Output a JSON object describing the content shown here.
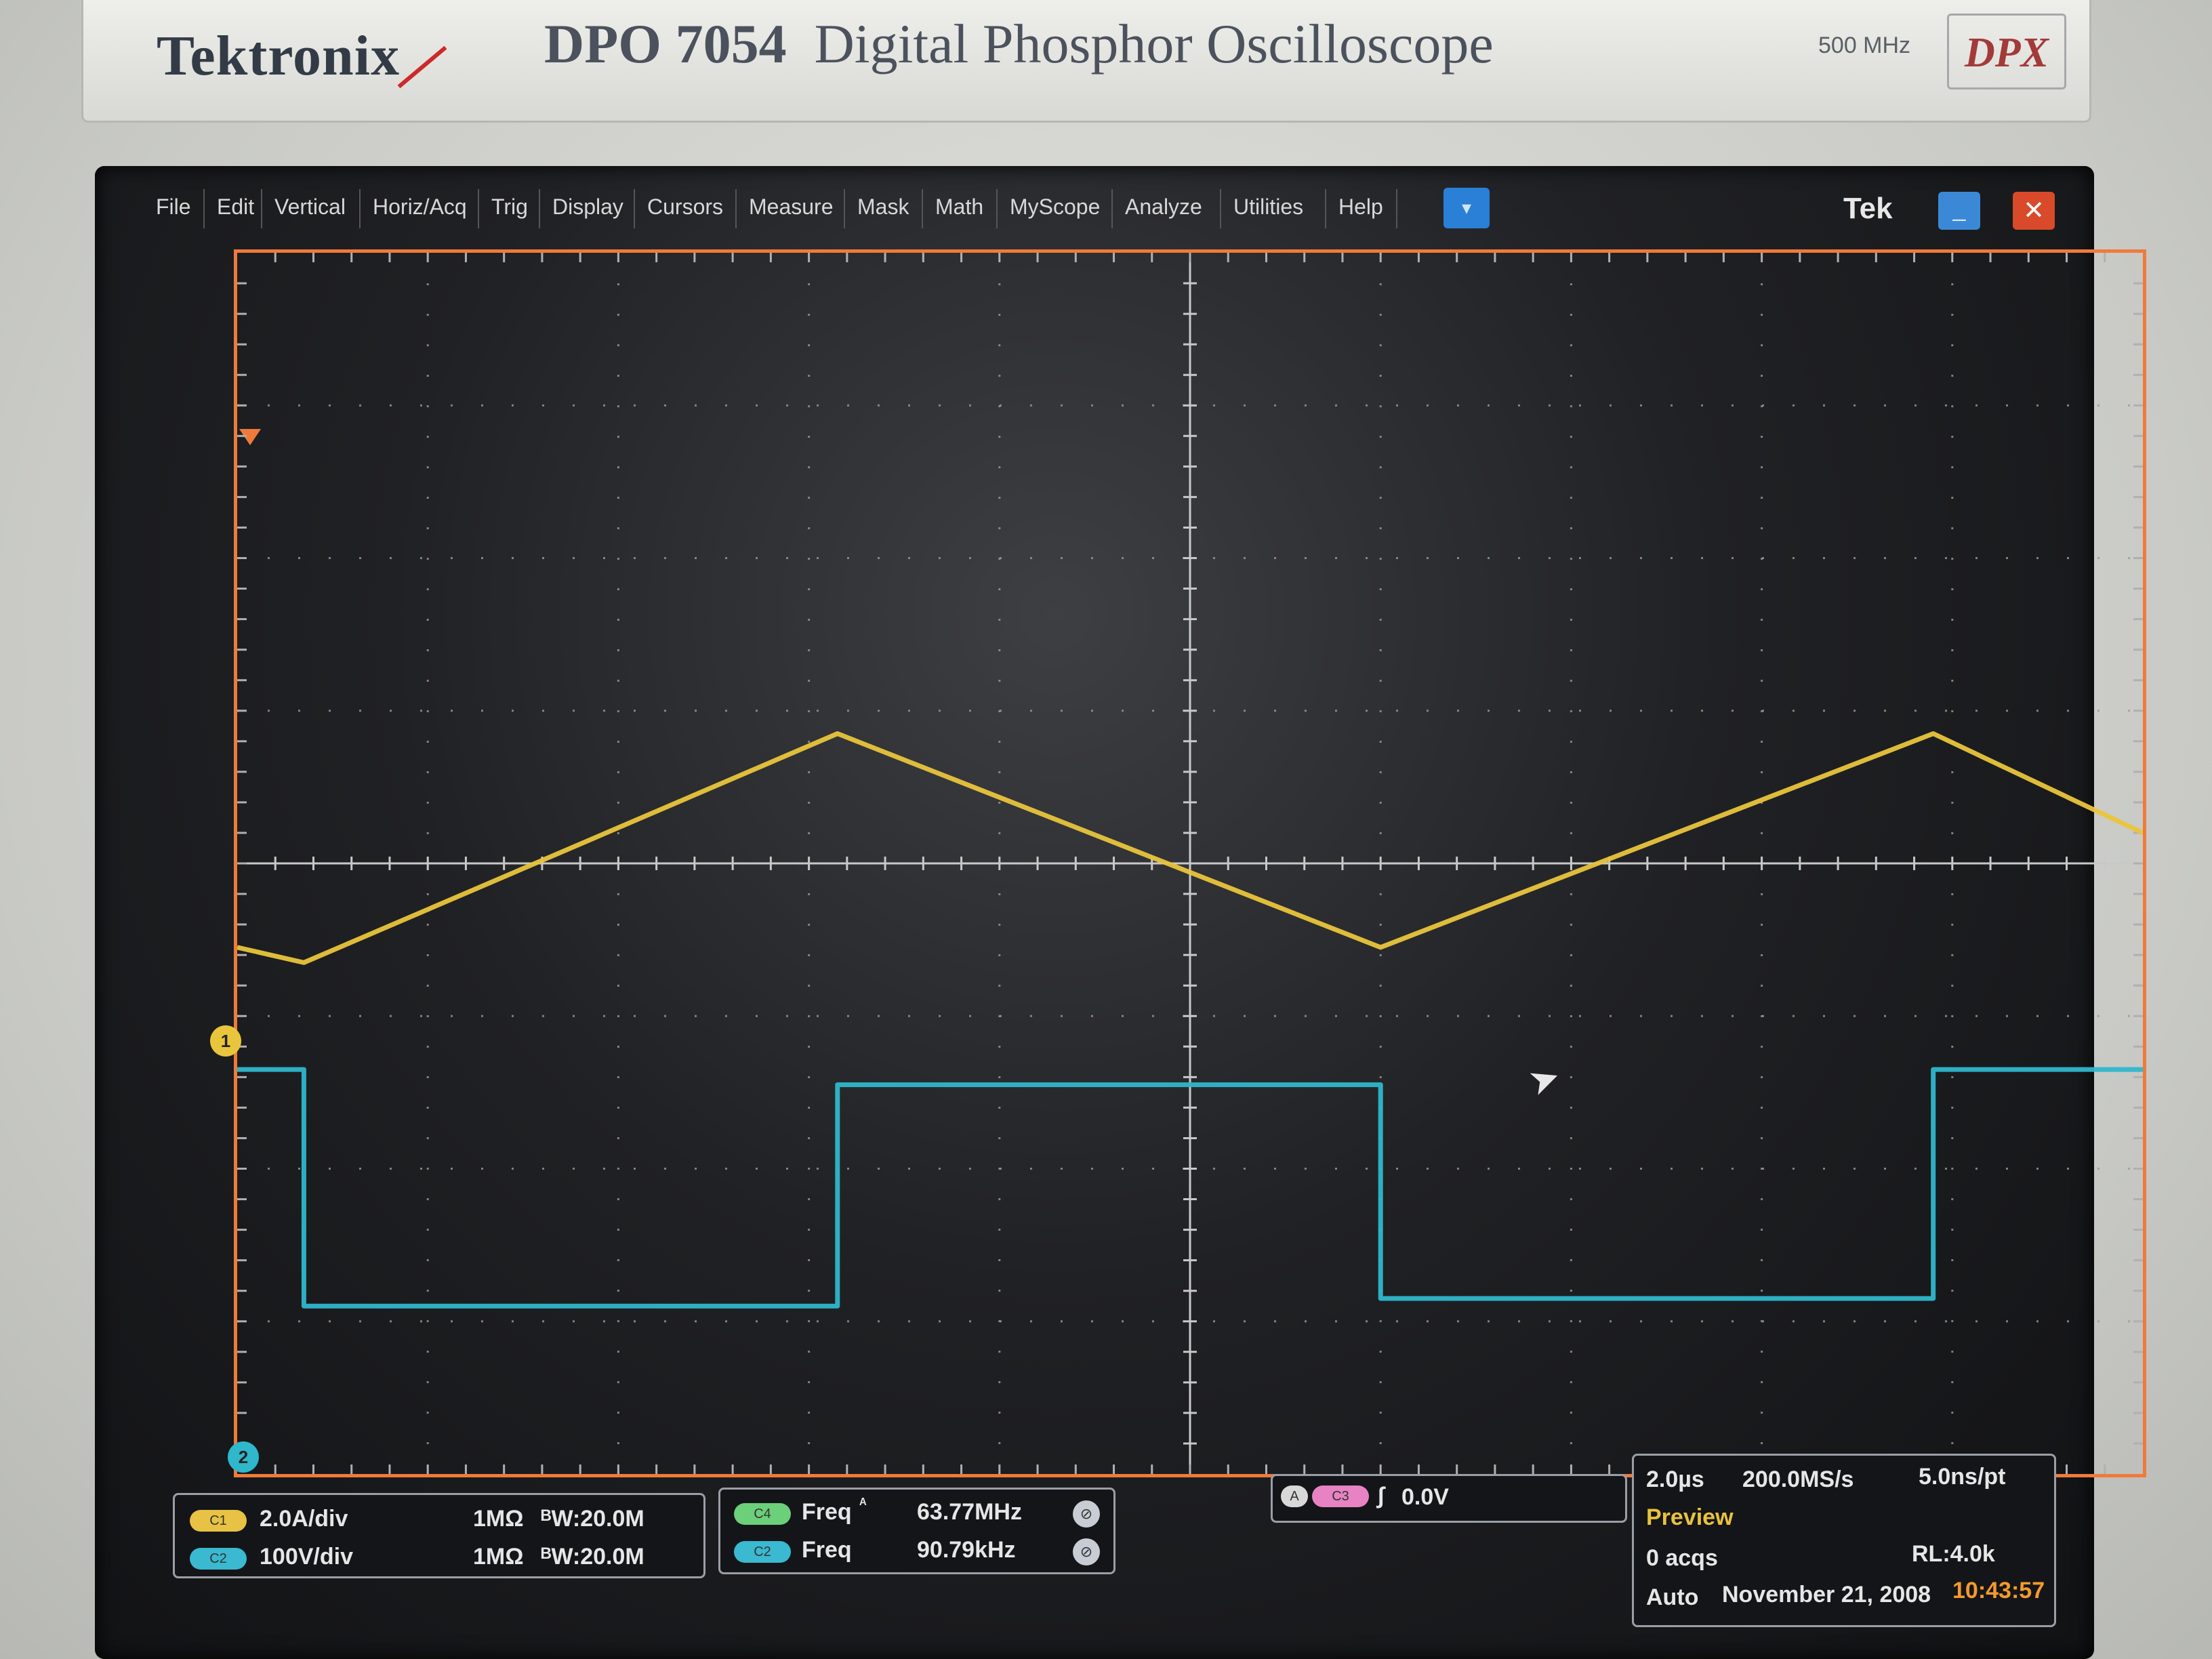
{
  "bezel": {
    "brand": "Tektronix",
    "model_number": "DPO 7054",
    "model_name": "Digital Phosphor Oscilloscope",
    "bandwidth": "500 MHz",
    "badge": "DPX"
  },
  "menu": {
    "items": [
      "File",
      "Edit",
      "Vertical",
      "Horiz/Acq",
      "Trig",
      "Display",
      "Cursors",
      "Measure",
      "Mask",
      "Math",
      "MyScope",
      "Analyze",
      "Utilities",
      "Help"
    ],
    "dropdown_icon": "▾",
    "brand_label": "Tek",
    "minimize_icon": "_",
    "close_icon": "✕"
  },
  "waveform_colors": {
    "ch1": "#e9c53c",
    "ch2": "#2fb7cc",
    "graticule": "#9b9b9b",
    "frame": "#f07a3a"
  },
  "markers": {
    "ch1": "1",
    "ch2": "2"
  },
  "channels": [
    {
      "chip": "C1",
      "scale": "2.0A/div",
      "impedance": "1MΩ",
      "bandwidth": "ᴮW:20.0M"
    },
    {
      "chip": "C2",
      "scale": "100V/div",
      "impedance": "1MΩ",
      "bandwidth": "ᴮW:20.0M"
    }
  ],
  "measurements": [
    {
      "chip": "C4",
      "name": "Freq",
      "qualifier": "ᴬ",
      "value": "63.77MHz"
    },
    {
      "chip": "C2",
      "name": "Freq",
      "qualifier": "",
      "value": "90.79kHz"
    }
  ],
  "trigger": {
    "mode": "A",
    "source": "C3",
    "slope_icon": "∫",
    "level": "0.0V"
  },
  "acquisition": {
    "time_per_div": "2.0µs",
    "sample_rate": "200.0MS/s",
    "resolution": "5.0ns/pt",
    "state": "Preview",
    "acqs": "0 acqs",
    "record_length": "RL:4.0k",
    "trigger_mode": "Auto",
    "date": "November 21, 2008",
    "time": "10:43:57"
  },
  "chart_data": {
    "type": "line",
    "x_divisions": 10,
    "y_divisions": 8,
    "x_unit": "div",
    "y_unit": "div",
    "series": [
      {
        "name": "C1",
        "x": [
          0.0,
          0.35,
          3.15,
          6.0,
          8.9,
          10.0
        ],
        "y": [
          -0.55,
          -0.65,
          0.85,
          -0.55,
          0.85,
          0.2
        ]
      },
      {
        "name": "C2",
        "x": [
          0.0,
          0.35,
          0.35,
          3.15,
          3.15,
          6.0,
          6.0,
          8.9,
          8.9,
          10.0
        ],
        "y": [
          -1.35,
          -1.35,
          -2.9,
          -2.9,
          -1.45,
          -1.45,
          -2.85,
          -2.85,
          -1.35,
          -1.35
        ]
      }
    ],
    "xlim": [
      0,
      10
    ],
    "ylim": [
      -4,
      4
    ],
    "grid": true
  }
}
